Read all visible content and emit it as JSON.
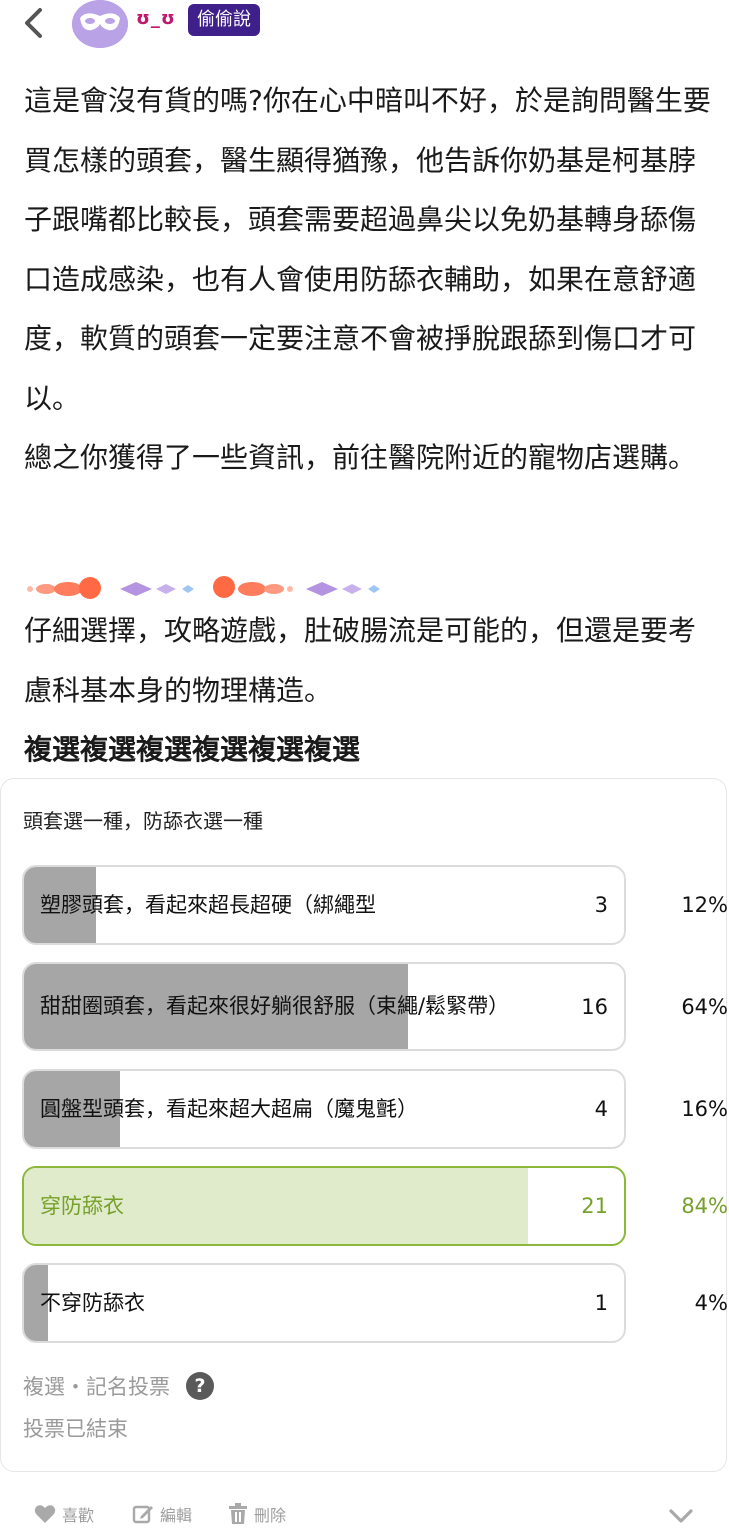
{
  "header": {
    "username": "ʊ_ʊ",
    "badge": "偷偷說"
  },
  "post": {
    "paragraphs": [
      "這是會沒有貨的嗎?你在心中暗叫不好，於是詢問醫生要買怎樣的頭套，醫生顯得猶豫，他告訴你奶基是柯基脖子跟嘴都比較長，頭套需要超過鼻尖以免奶基轉身舔傷口造成感染，也有人會使用防舔衣輔助，如果在意舒適度，軟質的頭套一定要注意不會被掙脫跟舔到傷口才可以。",
      "總之你獲得了一些資訊，前往醫院附近的寵物店選購。"
    ],
    "tail_paragraph": "仔細選擇，攻略遊戲，肚破腸流是可能的，但還是要考慮科基本身的物理構造。",
    "bold_line": "複選複選複選複選複選複選"
  },
  "poll": {
    "question": "頭套選一種，防舔衣選一種",
    "options": [
      {
        "label": "塑膠頭套，看起來超長超硬（綁繩型",
        "count": "3",
        "percent": "12%",
        "fraction": 0.12
      },
      {
        "label": "甜甜圈頭套，看起來很好躺很舒服（束繩/鬆緊帶）",
        "count": "16",
        "percent": "64%",
        "fraction": 0.64
      },
      {
        "label": "圓盤型頭套，看起來超大超扁（魔鬼氈）",
        "count": "4",
        "percent": "16%",
        "fraction": 0.16
      },
      {
        "label": "穿防舔衣",
        "count": "21",
        "percent": "84%",
        "fraction": 0.84
      },
      {
        "label": "不穿防舔衣",
        "count": "1",
        "percent": "4%",
        "fraction": 0.04
      }
    ],
    "meta": "複選・記名投票",
    "status": "投票已結束"
  },
  "actions": {
    "like": "喜歡",
    "edit": "編輯",
    "delete": "刪除"
  },
  "colors": {
    "accent_green": "#77a02a",
    "badge_bg": "#3f1f8a",
    "bar_gray": "#a6a6a6",
    "username": "#c2186b"
  }
}
